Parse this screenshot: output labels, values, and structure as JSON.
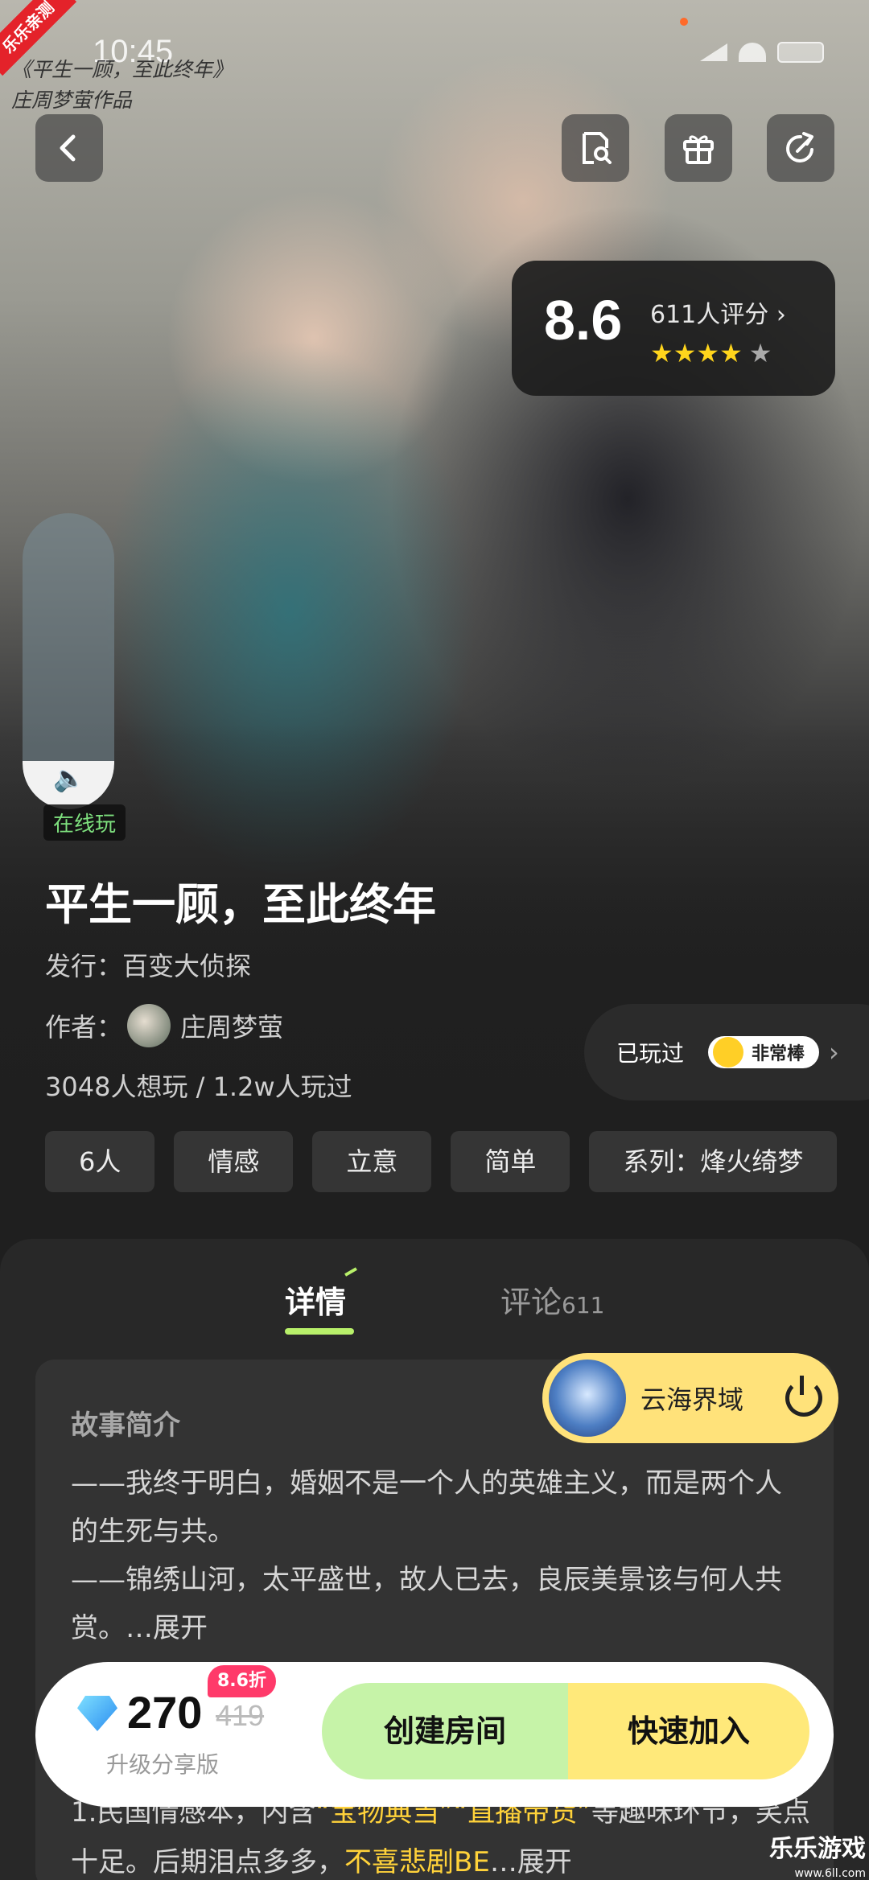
{
  "status_bar": {
    "time": "10:45"
  },
  "corner_badge": "乐乐亲测",
  "cover_caption": {
    "line1": "《平生一顾，至此终年》",
    "line2": "庄周梦萤作品"
  },
  "rating": {
    "score": "8.6",
    "count_label": "611人评分",
    "stars": 4.5,
    "star_glyphs": "★★★★"
  },
  "online_tag": "在线玩",
  "game": {
    "title": "平生一顾，至此终年",
    "publisher": "发行：百变大侦探",
    "author_label": "作者：",
    "author_name": "庄周梦萤",
    "stats": "3048人想玩 / 1.2w人玩过"
  },
  "played": {
    "label": "已玩过",
    "rating_label": "非常棒"
  },
  "tags": [
    "6人",
    "情感",
    "立意",
    "简单",
    "系列：烽火绮梦"
  ],
  "tabs": {
    "detail": "详情",
    "comment": "评论",
    "comment_count": "611"
  },
  "story": {
    "title": "故事简介",
    "line1": "——我终于明白，婚姻不是一个人的英雄主义，而是两个人的生死与共。",
    "line2": "——锦绣山河，太平盛世，故人已去，良辰美景该与何人共赏。…",
    "expand": "展开"
  },
  "features": {
    "part1": "1.民国情感本，内含",
    "hl1": "“宝物典当”",
    "hl2": "“直播带货”",
    "part2": "等趣味环节，笑点十足。后期泪点多多，",
    "hl3": "不喜悲剧BE",
    "part3": "…展开"
  },
  "server": {
    "name": "云海界域"
  },
  "purchase": {
    "price": "270",
    "original_price": "419",
    "discount": "8.6折",
    "edition": "升级分享版",
    "create_room": "创建房间",
    "quick_join": "快速加入"
  },
  "watermark": {
    "brand": "乐乐游戏",
    "url": "www.6ll.com"
  },
  "colors": {
    "accent_green": "#c6f3a8",
    "accent_yellow": "#ffe97a",
    "star": "#ffd51c",
    "discount": "#ff3a6a"
  }
}
